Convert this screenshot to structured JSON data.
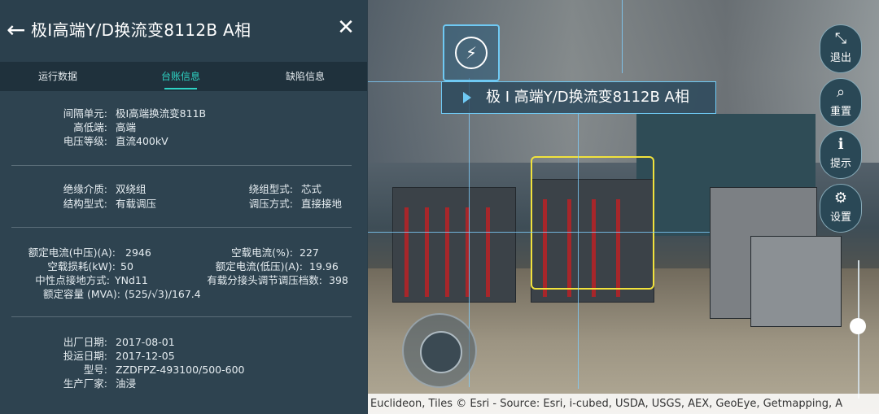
{
  "header": {
    "back_icon": "←",
    "title": "极I高端Y/D换流变8112B A相",
    "close_icon": "✕"
  },
  "tabs": [
    {
      "label": "运行数据",
      "active": false
    },
    {
      "label": "台账信息",
      "active": true
    },
    {
      "label": "缺陷信息",
      "active": false
    }
  ],
  "section1": [
    {
      "label": "间隔单元:",
      "value": "极I高端换流变811B"
    },
    {
      "label": "高低端:",
      "value": "高端"
    },
    {
      "label": "电压等级:",
      "value": "直流400kV"
    }
  ],
  "section2": [
    {
      "label": "绝缘介质:",
      "value": "双绕组",
      "label2": "绕组型式:",
      "value2": "芯式"
    },
    {
      "label": "结构型式:",
      "value": "有载调压",
      "label2": "调压方式:",
      "value2": "直接接地"
    }
  ],
  "section3": [
    {
      "label": "额定电流(中压)(A):",
      "value": "2946",
      "label2": "空载电流(%):",
      "value2": "227"
    },
    {
      "label": "空载损耗(kW):",
      "value": "50",
      "label2": "额定电流(低压)(A):",
      "value2": "19.96"
    },
    {
      "label": "中性点接地方式:",
      "value": "YNd11",
      "label2": "有载分接头调节调压档数:",
      "value2": "398"
    },
    {
      "label": "额定容量 (MVA):",
      "value": "(525/√3)/167.4"
    }
  ],
  "section4": [
    {
      "label": "出厂日期:",
      "value": "2017-08-01"
    },
    {
      "label": "投运日期:",
      "value": "2017-12-05"
    },
    {
      "label": "型号:",
      "value": "ZZDFPZ-493100/500-600"
    },
    {
      "label": "生产厂家:",
      "value": "油浸"
    }
  ],
  "scene": {
    "tag_label": "极 I 高端Y/D换流变8112B A相",
    "bolt_icon": "⚡",
    "controls": [
      {
        "icon": "⤡",
        "label": "退出"
      },
      {
        "icon": "⌕",
        "label": "重置"
      },
      {
        "icon": "ℹ",
        "label": "提示"
      },
      {
        "icon": "⚙",
        "label": "设置"
      }
    ],
    "attribution": "Euclideon, Tiles © Esri - Source: Esri, i-cubed, USDA, USGS, AEX, GeoEye, Getmapping, A"
  },
  "colors": {
    "accent": "#2ed3c4",
    "panel_bg": "#2e4350",
    "tabbar_bg": "#1f313c",
    "highlight": "#f1e23c"
  }
}
